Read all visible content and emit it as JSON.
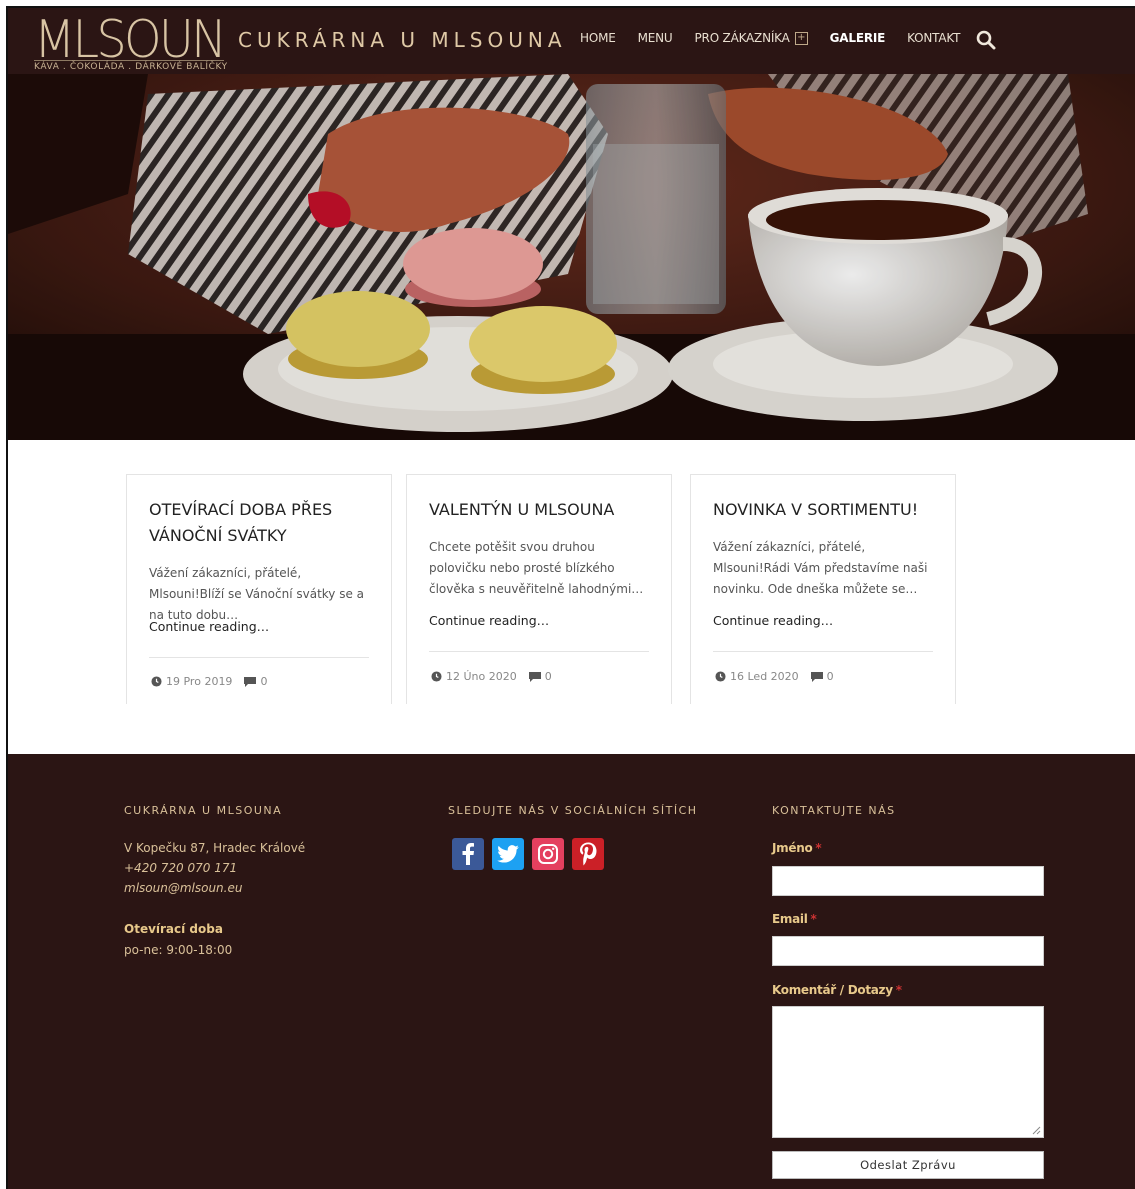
{
  "header": {
    "logo_text": "MLSOUN",
    "logo_tagline": "KÁVA . ČOKOLÁDA . DÁRKOVÉ BALÍČKY",
    "site_title": "CUKRÁRNA U MLSOUNA",
    "nav": [
      {
        "label": "HOME"
      },
      {
        "label": "MENU"
      },
      {
        "label": "PRO ZÁKAZNÍKA"
      },
      {
        "label": "GALERIE",
        "active": true
      },
      {
        "label": "KONTAKT"
      }
    ],
    "search_icon": "search-icon"
  },
  "posts": [
    {
      "title": "OTEVÍRACÍ DOBA PŘES VÁNOČNÍ SVÁTKY",
      "excerpt": "Vážení zákazníci, přátelé, Mlsouni!Blíží se Vánoční svátky se a na tuto dobu…",
      "more": "Continue reading…",
      "date": "19 Pro 2019",
      "comments": "0"
    },
    {
      "title": "VALENTÝN U MLSOUNA",
      "excerpt": "Chcete potěšit svou druhou polovičku nebo prosté blízkého člověka s neuvěřitelně lahodnými…",
      "more": "Continue reading…",
      "date": "12 Úno 2020",
      "comments": "0"
    },
    {
      "title": "NOVINKA V SORTIMENTU!",
      "excerpt": "Vážení zákazníci, přátelé, Mlsouni!Rádi Vám představíme naši novinku. Ode dneška můžete se…",
      "more": "Continue reading…",
      "date": "16 Led 2020",
      "comments": "0"
    }
  ],
  "footer": {
    "col1_title": "CUKRÁRNA U MLSOUNA",
    "address": "V Kopečku 87, Hradec Králové",
    "phone": "+420 720 070 171",
    "email": "mlsoun@mlsoun.eu",
    "hours_title": "Otevírací doba",
    "hours": "po-ne: 9:00-18:00",
    "col2_title": "SLEDUJTE NÁS V SOCIÁLNÍCH SÍTÍCH",
    "social": [
      "facebook-icon",
      "twitter-icon",
      "instagram-icon",
      "pinterest-icon"
    ],
    "col3_title": "KONTAKTUJTE NÁS",
    "form": {
      "name_label": "Jméno",
      "email_label": "Email",
      "comment_label": "Komentář / Dotazy",
      "required_mark": "*",
      "submit": "Odeslat Zprávu"
    }
  },
  "colors": {
    "header_bg": "#2b1514",
    "footer_bg": "#2b1514",
    "gold": "#d9c099",
    "facebook": "#3b5998",
    "twitter": "#1da1f2",
    "instagram": "#e4405f",
    "pinterest": "#cb2027"
  }
}
